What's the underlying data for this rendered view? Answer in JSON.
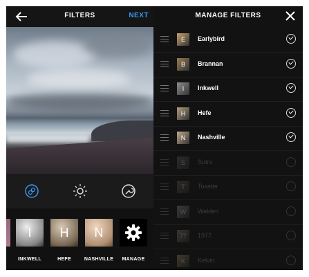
{
  "left_panel": {
    "back_icon": "arrow-left-icon",
    "title": "FILTERS",
    "next_label": "NEXT",
    "accent_color": "#3897f0",
    "tools": [
      {
        "name": "filter-tool-icon",
        "active": true
      },
      {
        "name": "brightness-icon",
        "active": false
      },
      {
        "name": "edit-wrench-icon",
        "active": false
      }
    ],
    "filters": [
      {
        "label": "",
        "letter": ""
      },
      {
        "label": "INKWELL",
        "letter": "I"
      },
      {
        "label": "HEFE",
        "letter": "H"
      },
      {
        "label": "NASHVILLE",
        "letter": "N"
      },
      {
        "label": "MANAGE",
        "letter": ""
      }
    ]
  },
  "right_panel": {
    "title": "MANAGE FILTERS",
    "close_icon": "close-icon",
    "filters": [
      {
        "name": "Earlybird",
        "letter": "E",
        "enabled": true
      },
      {
        "name": "Brannan",
        "letter": "B",
        "enabled": true
      },
      {
        "name": "Inkwell",
        "letter": "I",
        "enabled": true
      },
      {
        "name": "Hefe",
        "letter": "H",
        "enabled": true
      },
      {
        "name": "Nashville",
        "letter": "N",
        "enabled": true
      },
      {
        "name": "Sutro",
        "letter": "S",
        "enabled": false
      },
      {
        "name": "Toaster",
        "letter": "T",
        "enabled": false
      },
      {
        "name": "Walden",
        "letter": "W",
        "enabled": false
      },
      {
        "name": "1977",
        "letter": "77",
        "enabled": false
      },
      {
        "name": "Kelvin",
        "letter": "K",
        "enabled": false
      }
    ]
  }
}
